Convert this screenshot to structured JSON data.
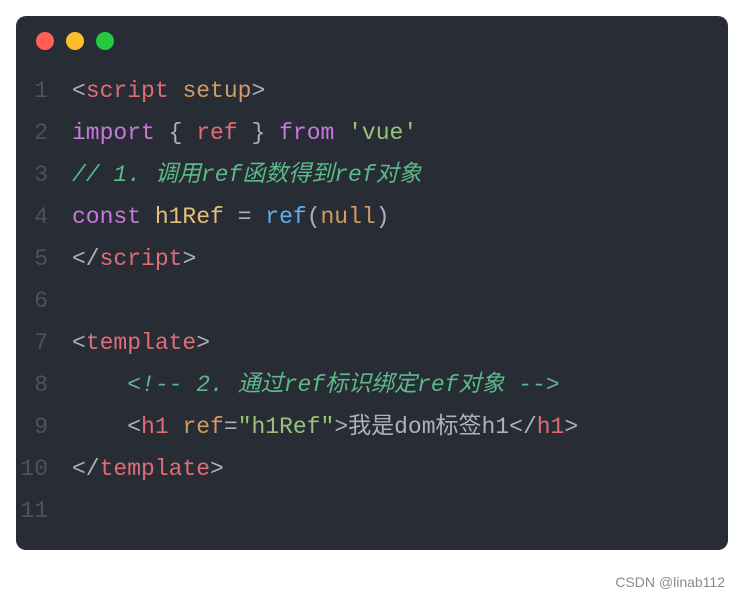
{
  "window": {
    "trafficLights": [
      "red",
      "yellow",
      "green"
    ]
  },
  "lines": [
    {
      "num": "1"
    },
    {
      "num": "2"
    },
    {
      "num": "3"
    },
    {
      "num": "4"
    },
    {
      "num": "5"
    },
    {
      "num": "6"
    },
    {
      "num": "7"
    },
    {
      "num": "8"
    },
    {
      "num": "9"
    },
    {
      "num": "10"
    },
    {
      "num": "11"
    }
  ],
  "tokens": {
    "l1": {
      "open": "<",
      "tag": "script",
      "attr": "setup",
      "close": ">"
    },
    "l2": {
      "kw1": "import",
      "brace1": " { ",
      "var": "ref",
      "brace2": " } ",
      "kw2": "from",
      "str": "'vue'"
    },
    "l3": {
      "comment": "// 1. 调用ref函数得到ref对象"
    },
    "l4": {
      "kw": "const",
      "name": "h1Ref",
      "eq": " = ",
      "func": "ref",
      "p1": "(",
      "arg": "null",
      "p2": ")"
    },
    "l5": {
      "open": "</",
      "tag": "script",
      "close": ">"
    },
    "l7": {
      "open": "<",
      "tag": "template",
      "close": ">"
    },
    "l8": {
      "indent": "    ",
      "comment": "<!-- 2. 通过ref标识绑定ref对象 -->"
    },
    "l9": {
      "indent": "    ",
      "open": "<",
      "tag": "h1",
      "attr": "ref",
      "eq": "=",
      "val": "\"h1Ref\"",
      "close": ">",
      "text": "我是dom标签h1",
      "open2": "</",
      "tag2": "h1",
      "close2": ">"
    },
    "l10": {
      "open": "</",
      "tag": "template",
      "close": ">"
    }
  },
  "watermark": "CSDN @linab112"
}
